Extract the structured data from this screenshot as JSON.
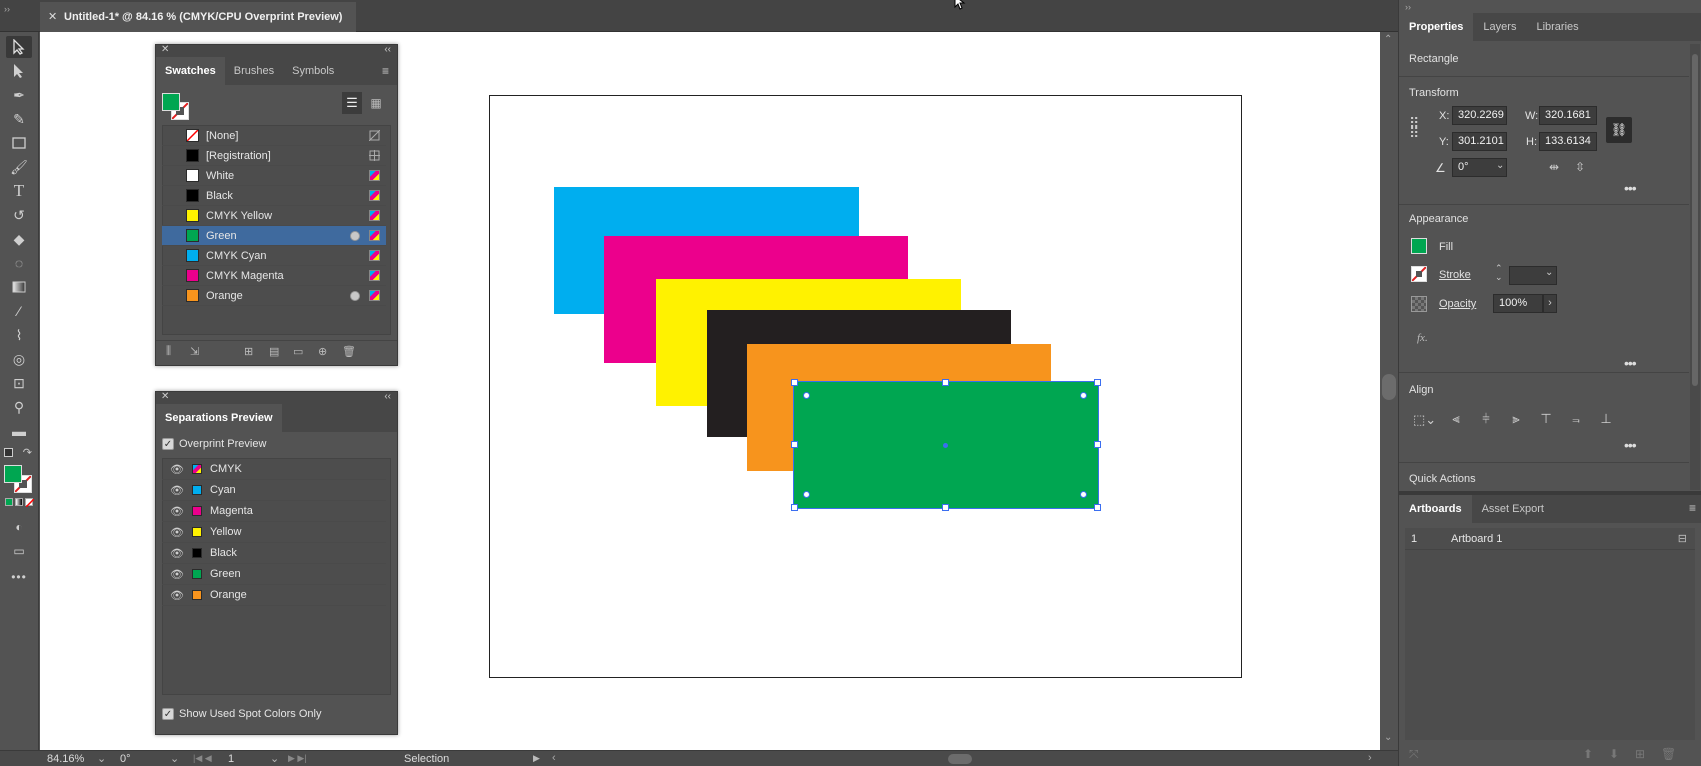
{
  "document": {
    "tab_title": "Untitled-1* @ 84.16 % (CMYK/CPU Overprint Preview)"
  },
  "swatches_panel": {
    "tabs": [
      "Swatches",
      "Brushes",
      "Symbols"
    ],
    "items": [
      {
        "name": "[None]",
        "color": "none"
      },
      {
        "name": "[Registration]",
        "color": "#000000"
      },
      {
        "name": "White",
        "color": "#ffffff"
      },
      {
        "name": "Black",
        "color": "#000000"
      },
      {
        "name": "CMYK Yellow",
        "color": "#fff200"
      },
      {
        "name": "Green",
        "color": "#00a651"
      },
      {
        "name": "CMYK Cyan",
        "color": "#00aeef"
      },
      {
        "name": "CMYK Magenta",
        "color": "#ec008c"
      },
      {
        "name": "Orange",
        "color": "#f7941d"
      }
    ]
  },
  "separations_panel": {
    "title": "Separations Preview",
    "overprint_label": "Overprint Preview",
    "items": [
      {
        "name": "CMYK",
        "color": "cmyk"
      },
      {
        "name": "Cyan",
        "color": "#00aeef"
      },
      {
        "name": "Magenta",
        "color": "#ec008c"
      },
      {
        "name": "Yellow",
        "color": "#fff200"
      },
      {
        "name": "Black",
        "color": "#000000"
      },
      {
        "name": "Green",
        "color": "#00a651"
      },
      {
        "name": "Orange",
        "color": "#f7941d"
      }
    ],
    "show_used_label": "Show Used Spot Colors Only"
  },
  "properties": {
    "tabs": [
      "Properties",
      "Layers",
      "Libraries"
    ],
    "object_type": "Rectangle",
    "transform_heading": "Transform",
    "x_label": "X:",
    "x": "320.2269",
    "y_label": "Y:",
    "y": "301.2101",
    "w_label": "W:",
    "w": "320.1681",
    "h_label": "H:",
    "h": "133.6134",
    "rotation": "0°",
    "appearance_heading": "Appearance",
    "fill_label": "Fill",
    "stroke_label": "Stroke",
    "opacity_label": "Opacity",
    "opacity": "100%",
    "fx_label": "fx.",
    "align_heading": "Align",
    "quick_actions_heading": "Quick Actions"
  },
  "artboards_panel": {
    "tabs": [
      "Artboards",
      "Asset Export"
    ],
    "rows": [
      {
        "index": "1",
        "name": "Artboard 1"
      }
    ]
  },
  "status_bar": {
    "zoom": "84.16%",
    "rotation": "0°",
    "artboard_num": "1",
    "tool": "Selection"
  },
  "artwork_colors": {
    "cyan": "#00aeef",
    "magenta": "#ec008c",
    "yellow": "#fff200",
    "black": "#231f20",
    "orange": "#f7941d",
    "green": "#00a651"
  }
}
